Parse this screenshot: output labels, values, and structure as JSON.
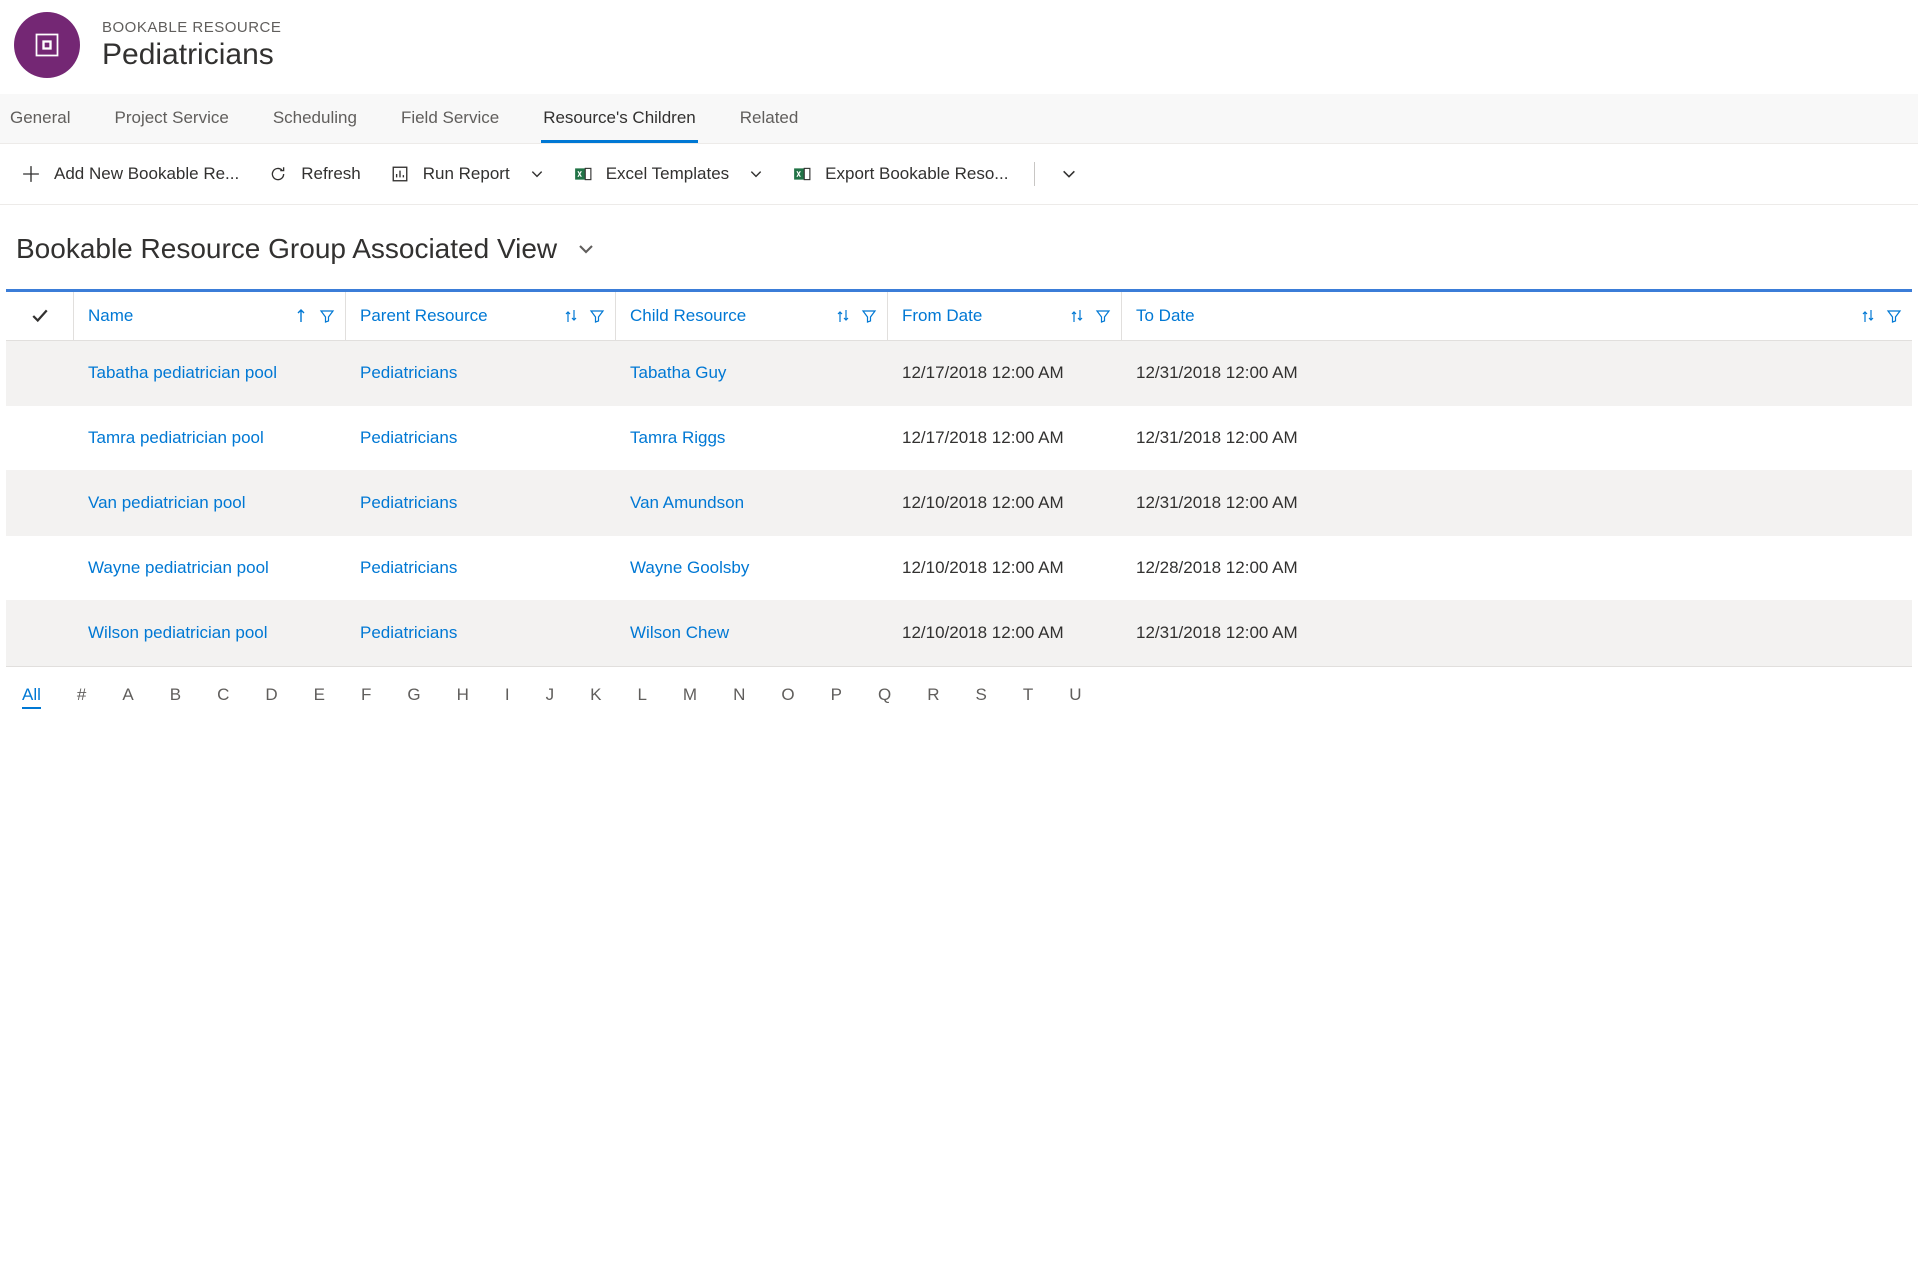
{
  "record": {
    "type_label": "BOOKABLE RESOURCE",
    "title": "Pediatricians"
  },
  "tabs": [
    {
      "label": "General",
      "active": false
    },
    {
      "label": "Project Service",
      "active": false
    },
    {
      "label": "Scheduling",
      "active": false
    },
    {
      "label": "Field Service",
      "active": false
    },
    {
      "label": "Resource's Children",
      "active": true
    },
    {
      "label": "Related",
      "active": false
    }
  ],
  "toolbar": {
    "add_new": "Add New Bookable Re...",
    "refresh": "Refresh",
    "run_report": "Run Report",
    "excel_templates": "Excel Templates",
    "export": "Export Bookable Reso..."
  },
  "view": {
    "title": "Bookable Resource Group Associated View"
  },
  "columns": {
    "name": "Name",
    "parent": "Parent Resource",
    "child": "Child Resource",
    "from": "From Date",
    "to": "To Date"
  },
  "rows": [
    {
      "name": "Tabatha pediatrician pool",
      "parent": "Pediatricians",
      "child": "Tabatha Guy",
      "from": "12/17/2018 12:00 AM",
      "to": "12/31/2018 12:00 AM"
    },
    {
      "name": "Tamra pediatrician pool",
      "parent": "Pediatricians",
      "child": "Tamra Riggs",
      "from": "12/17/2018 12:00 AM",
      "to": "12/31/2018 12:00 AM"
    },
    {
      "name": "Van pediatrician pool",
      "parent": "Pediatricians",
      "child": "Van Amundson",
      "from": "12/10/2018 12:00 AM",
      "to": "12/31/2018 12:00 AM"
    },
    {
      "name": "Wayne pediatrician pool",
      "parent": "Pediatricians",
      "child": "Wayne Goolsby",
      "from": "12/10/2018 12:00 AM",
      "to": "12/28/2018 12:00 AM"
    },
    {
      "name": "Wilson pediatrician pool",
      "parent": "Pediatricians",
      "child": "Wilson Chew",
      "from": "12/10/2018 12:00 AM",
      "to": "12/31/2018 12:00 AM"
    }
  ],
  "jump_bar": [
    "All",
    "#",
    "A",
    "B",
    "C",
    "D",
    "E",
    "F",
    "G",
    "H",
    "I",
    "J",
    "K",
    "L",
    "M",
    "N",
    "O",
    "P",
    "Q",
    "R",
    "S",
    "T",
    "U"
  ]
}
